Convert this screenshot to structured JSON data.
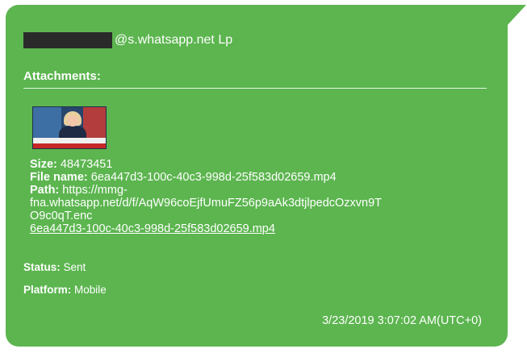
{
  "message": {
    "sender_suffix": "@s.whatsapp.net Lp",
    "attachments_label": "Attachments:",
    "attachment": {
      "size_label": "Size:",
      "size_value": "48473451",
      "file_name_label": "File name:",
      "file_name_value": "6ea447d3-100c-40c3-998d-25f583d02659.mp4",
      "path_label": "Path:",
      "path_line1": "https://mmg-",
      "path_line2": "fna.whatsapp.net/d/f/AqW96coEjfUmuFZ56p9aAk3dtjlpedcOzxvn9T",
      "path_line3": "O9c0qT.enc",
      "link_text": "6ea447d3-100c-40c3-998d-25f583d02659.mp4"
    },
    "status_label": "Status:",
    "status_value": "Sent",
    "platform_label": "Platform:",
    "platform_value": "Mobile",
    "timestamp": "3/23/2019 3:07:02 AM(UTC+0)"
  },
  "colors": {
    "bubble": "#5cb54f",
    "text": "#ffffff",
    "redaction": "#2a2a2a"
  }
}
